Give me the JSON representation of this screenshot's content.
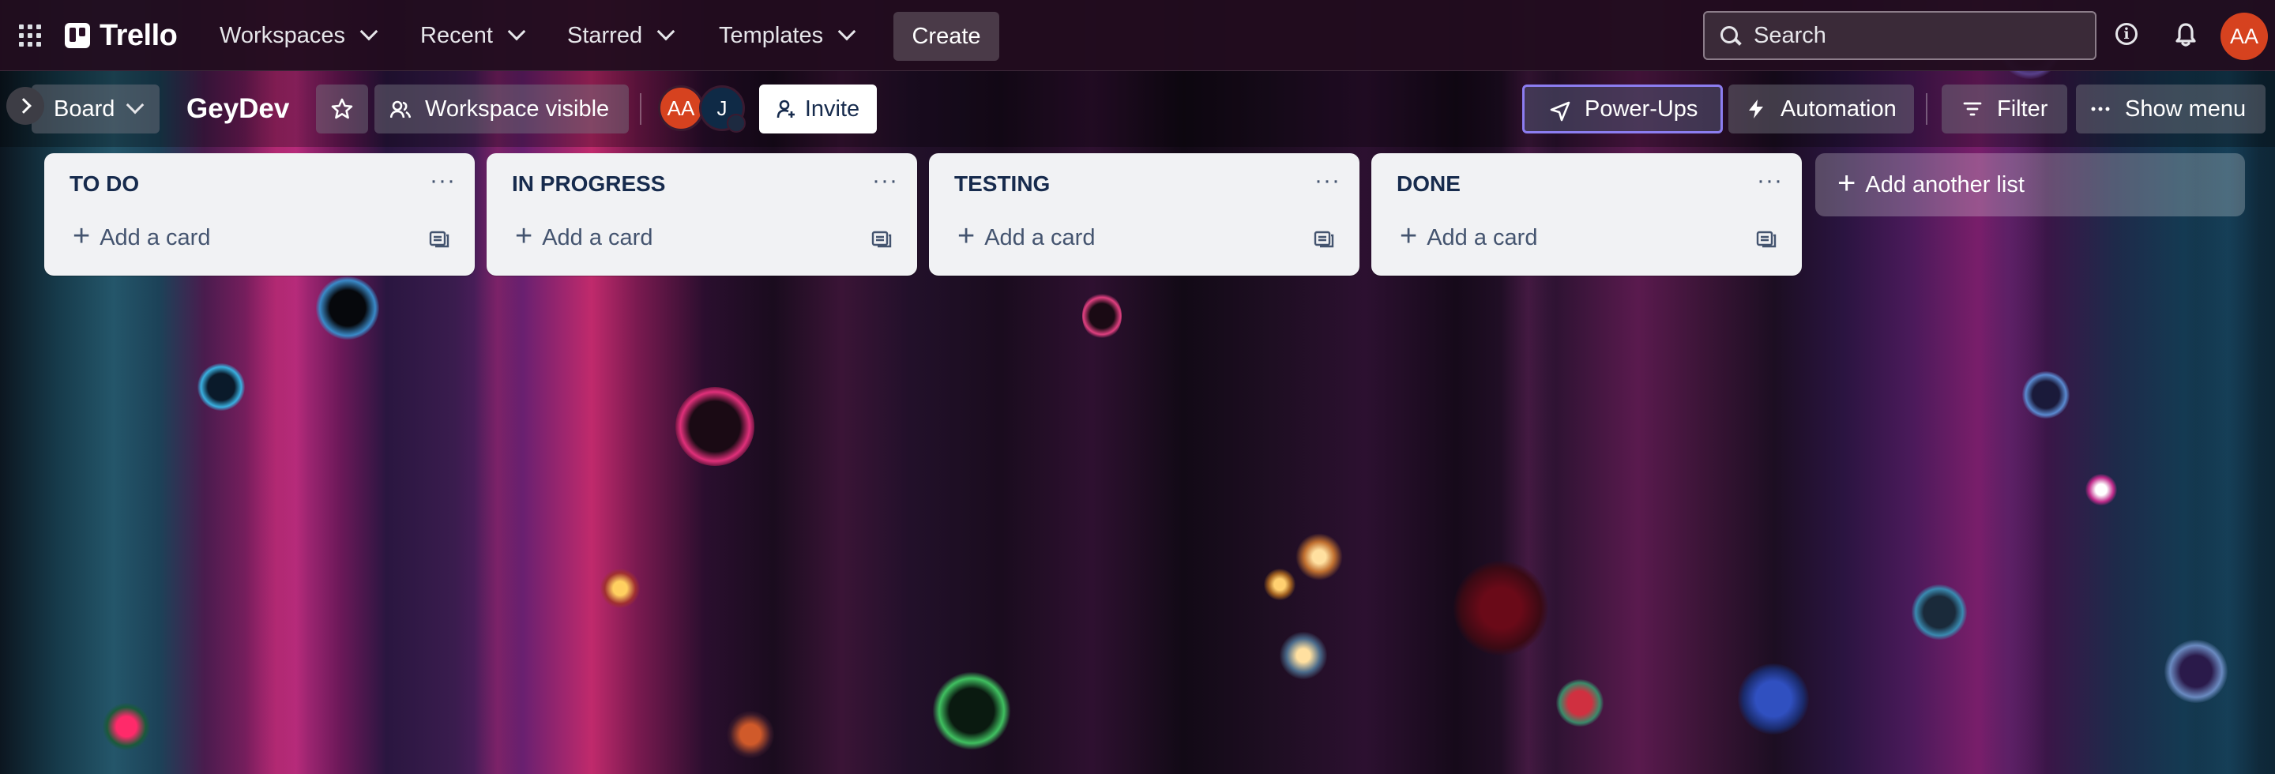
{
  "header": {
    "app_name": "Trello",
    "nav": {
      "workspaces": "Workspaces",
      "recent": "Recent",
      "starred": "Starred",
      "templates": "Templates"
    },
    "create_label": "Create",
    "search_placeholder": "Search",
    "avatar_initials": "AA"
  },
  "board": {
    "view_label": "Board",
    "title": "GeyDev",
    "visibility_label": "Workspace visible",
    "members": [
      {
        "initials": "AA",
        "color": "#d6421f"
      },
      {
        "initials": "J",
        "color": "#0f2a46"
      }
    ],
    "invite_label": "Invite",
    "powerups_label": "Power-Ups",
    "automation_label": "Automation",
    "filter_label": "Filter",
    "show_menu_label": "Show menu"
  },
  "lists": [
    {
      "title": "TO DO",
      "add_card": "Add a card"
    },
    {
      "title": "IN PROGRESS",
      "add_card": "Add a card"
    },
    {
      "title": "TESTING",
      "add_card": "Add a card"
    },
    {
      "title": "DONE",
      "add_card": "Add a card"
    }
  ],
  "add_list_label": "Add another list",
  "colors": {
    "accent_avatar": "#d6421f",
    "powerups_border": "#8c7df0",
    "list_background": "#f1f2f4",
    "list_text": "#172b4d"
  }
}
